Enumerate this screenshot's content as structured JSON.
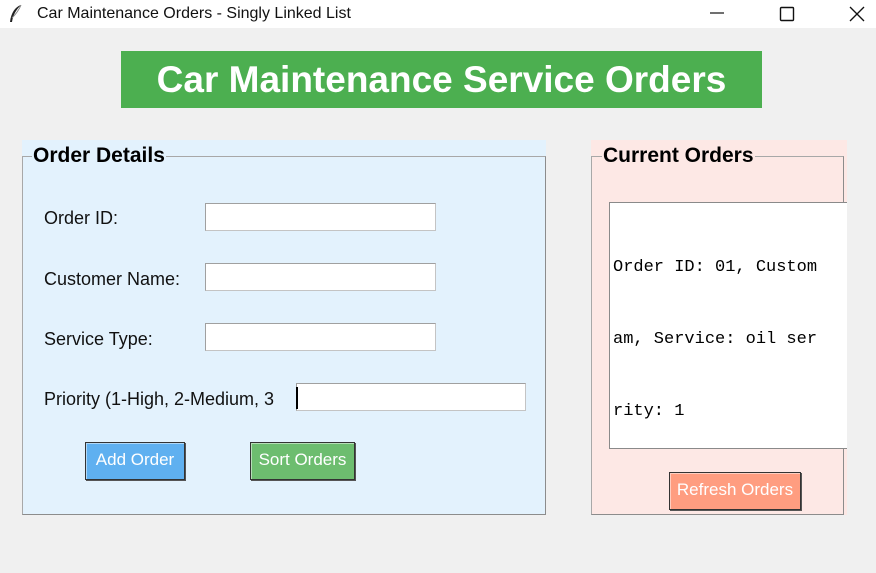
{
  "window": {
    "title": "Car Maintenance Orders - Singly Linked List",
    "controls": [
      "minimize",
      "maximize",
      "close"
    ]
  },
  "header": {
    "title": "Car Maintenance Service Orders",
    "background": "#4caf50"
  },
  "order_details": {
    "title": "Order Details",
    "background": "#e3f2fd",
    "fields": {
      "order_id": {
        "label": "Order ID:",
        "value": ""
      },
      "customer_name": {
        "label": "Customer Name:",
        "value": ""
      },
      "service_type": {
        "label": "Service Type:",
        "value": ""
      },
      "priority": {
        "label": "Priority (1-High, 2-Medium, 3",
        "value": ""
      }
    },
    "buttons": {
      "add": {
        "label": "Add Order",
        "color": "#5fb0f0"
      },
      "sort": {
        "label": "Sort Orders",
        "color": "#6dbd6f"
      }
    }
  },
  "current_orders": {
    "title": "Current Orders",
    "background": "#fde8e5",
    "lines": [
      "Order ID: 01, Custom",
      "am, Service: oil ser",
      "rity: 1"
    ],
    "refresh_button": {
      "label": "Refresh Orders",
      "color": "#ff9d80"
    }
  }
}
